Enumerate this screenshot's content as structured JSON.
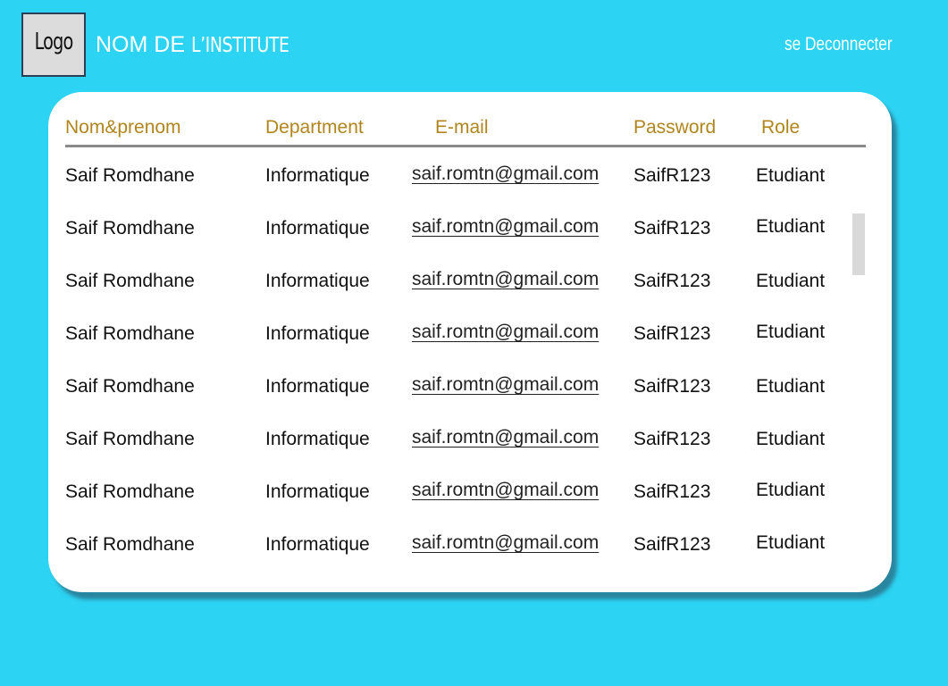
{
  "header": {
    "logo_label": "Logo",
    "title_main": "NOM DE",
    "title_rest": "L’INSTITUTE",
    "logout_label": "se Deconnecter"
  },
  "colors": {
    "background": "#2dd3f3",
    "header_text": "#b0851e",
    "panel": "#ffffff"
  },
  "table": {
    "columns": [
      "Nom&prenom",
      "Department",
      "E-mail",
      "Password",
      "Role"
    ],
    "rows": [
      [
        "Saif Romdhane",
        "Informatique",
        "saif.romtn@gmail.com",
        "SaifR123",
        "Etudiant"
      ],
      [
        "Saif Romdhane",
        "Informatique",
        "saif.romtn@gmail.com",
        "SaifR123",
        "Etudiant"
      ],
      [
        "Saif Romdhane",
        "Informatique",
        "saif.romtn@gmail.com",
        "SaifR123",
        "Etudiant"
      ],
      [
        "Saif Romdhane",
        "Informatique",
        "saif.romtn@gmail.com",
        "SaifR123",
        "Etudiant"
      ],
      [
        "Saif Romdhane",
        "Informatique",
        "saif.romtn@gmail.com",
        "SaifR123",
        "Etudiant"
      ],
      [
        "Saif Romdhane",
        "Informatique",
        "saif.romtn@gmail.com",
        "SaifR123",
        "Etudiant"
      ],
      [
        "Saif Romdhane",
        "Informatique",
        "saif.romtn@gmail.com",
        "SaifR123",
        "Etudiant"
      ],
      [
        "Saif Romdhane",
        "Informatique",
        "saif.romtn@gmail.com",
        "SaifR123",
        "Etudiant"
      ]
    ]
  }
}
